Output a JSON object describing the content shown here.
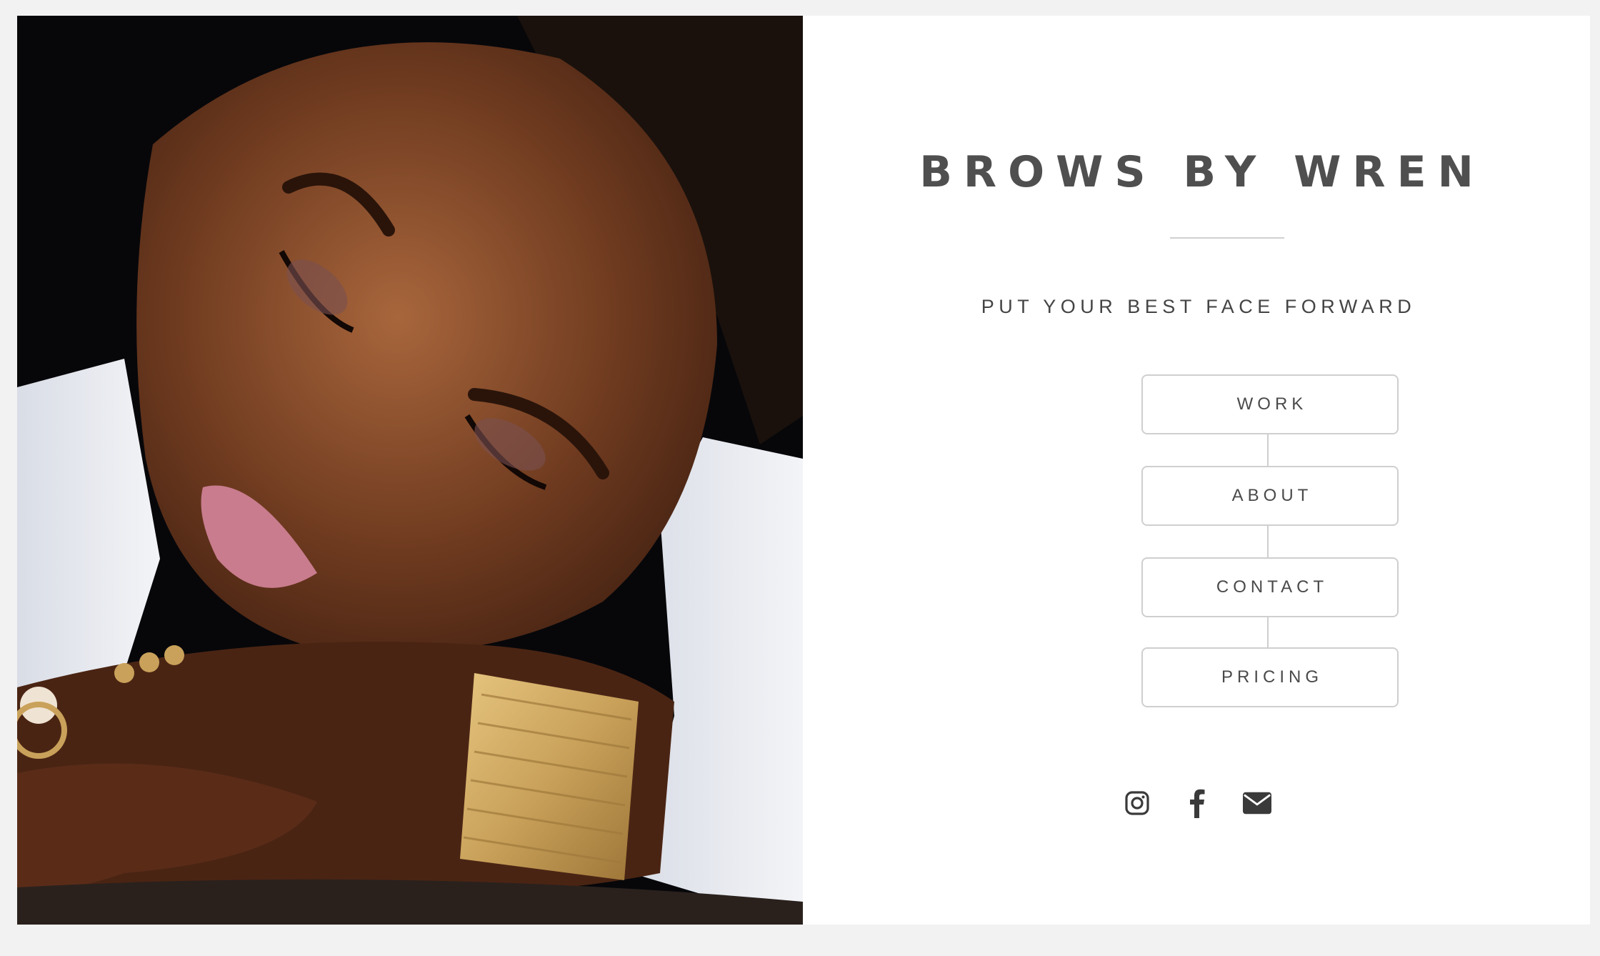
{
  "brand": {
    "title": "BROWS BY WREN",
    "tagline": "PUT YOUR BEST FACE FORWARD"
  },
  "nav": {
    "items": [
      {
        "label": "WORK"
      },
      {
        "label": "ABOUT"
      },
      {
        "label": "CONTACT"
      },
      {
        "label": "PRICING"
      }
    ]
  },
  "social": {
    "icons": [
      "instagram-icon",
      "facebook-icon",
      "email-icon"
    ]
  },
  "colors": {
    "page_background": "#f2f2f2",
    "panel_background": "#ffffff",
    "text": "#4f4f4f",
    "button_border": "#cfcfcf"
  }
}
